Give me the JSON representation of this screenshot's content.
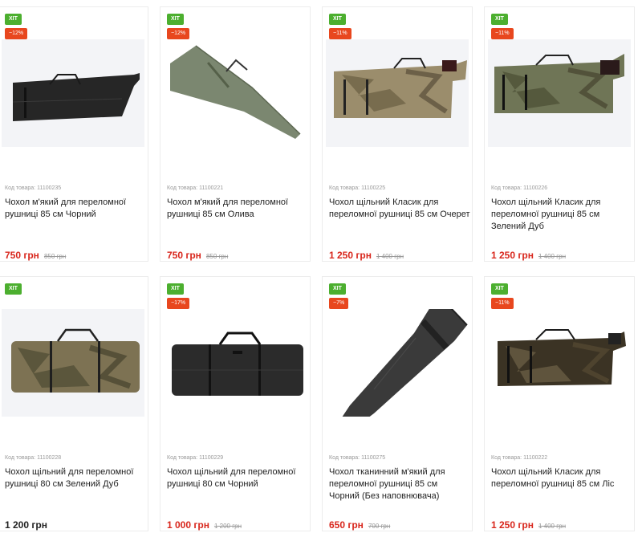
{
  "code_label": "Код товара:",
  "products": [
    {
      "badge": "ХІТ",
      "discount": "−12%",
      "code": "11100235",
      "title": "Чохол м'який для переломної рушниці 85 см Чорний",
      "price": "750 грн",
      "old_price": "850 грн",
      "image": "gun-case-black"
    },
    {
      "badge": "ХІТ",
      "discount": "−12%",
      "code": "11100221",
      "title": "Чохол м'який для переломної рушниці 85 см Олива",
      "price": "750 грн",
      "old_price": "850 грн",
      "image": "gun-case-olive"
    },
    {
      "badge": "ХІТ",
      "discount": "−11%",
      "code": "11100225",
      "title": "Чохол щільний Класик для переломної рушниці 85 см Очерет",
      "price": "1 250 грн",
      "old_price": "1 400 грн",
      "image": "gun-case-reed-camo"
    },
    {
      "badge": "ХІТ",
      "discount": "−11%",
      "code": "11100226",
      "title": "Чохол щільний Класик для переломної рушниці 85 см Зелений Дуб",
      "price": "1 250 грн",
      "old_price": "1 400 грн",
      "image": "gun-case-oak-camo"
    },
    {
      "badge": "ХІТ",
      "discount": "",
      "code": "11100228",
      "title": "Чохол щільний для переломної рушниці 80 см Зелений Дуб",
      "price": "1 200 грн",
      "old_price": "",
      "image": "rectangular-case-camo"
    },
    {
      "badge": "ХІТ",
      "discount": "−17%",
      "code": "11100229",
      "title": "Чохол щільний для переломної рушниці 80 см Чорний",
      "price": "1 000 грн",
      "old_price": "1 200 грн",
      "image": "rectangular-case-black"
    },
    {
      "badge": "ХІТ",
      "discount": "−7%",
      "code": "11100275",
      "title": "Чохол тканинний м'який для переломної рушниці 85 см Чорний (Без наповнювача)",
      "price": "650 грн",
      "old_price": "700 грн",
      "image": "soft-case-black-diagonal"
    },
    {
      "badge": "ХІТ",
      "discount": "−11%",
      "code": "11100222",
      "title": "Чохол щільний Класик для переломної рушниці 85 см Ліс",
      "price": "1 250 грн",
      "old_price": "1 400 грн",
      "image": "gun-case-forest-camo"
    }
  ]
}
